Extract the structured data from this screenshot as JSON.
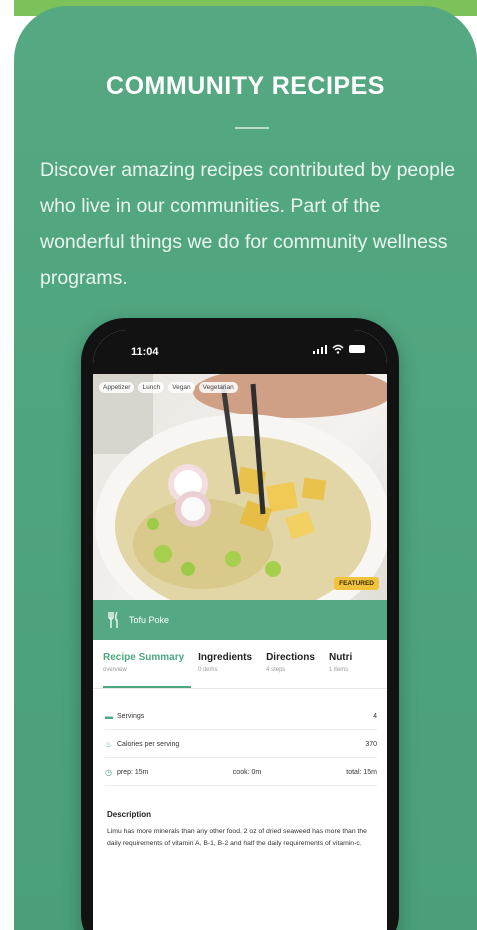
{
  "promo": {
    "headline": "COMMUNITY RECIPES",
    "intro": "Discover amazing recipes contributed by people who live in our communities. Part of the wonderful things we do for community wellness programs."
  },
  "phone": {
    "status_time": "11:04"
  },
  "recipe": {
    "chips": [
      "Appetizer",
      "Lunch",
      "Vegan",
      "Vegetarian"
    ],
    "featured_badge": "FEATURED",
    "name": "Tofu Poke",
    "tabs": [
      {
        "label": "Recipe Summary",
        "sub": "overview"
      },
      {
        "label": "Ingredients",
        "sub": "0 items"
      },
      {
        "label": "Directions",
        "sub": "4 steps"
      },
      {
        "label": "Nutri",
        "sub": "1 items"
      }
    ],
    "servings": {
      "label": "Servings",
      "value": "4"
    },
    "calories": {
      "label": "Calories per serving",
      "value": "370"
    },
    "time": {
      "prep": "prep: 15m",
      "cook": "cook: 0m",
      "total": "total: 15m"
    },
    "description_title": "Description",
    "description": "Limu has more minerals than any other food. 2 oz of dried seaweed has more than the daily requirements of vitamin A, B-1, B-2 and half the daily requirements of vitamin-c."
  },
  "colors": {
    "background": "#4fa57f",
    "accent": "#4ba77f",
    "featured": "#f1c23b"
  }
}
